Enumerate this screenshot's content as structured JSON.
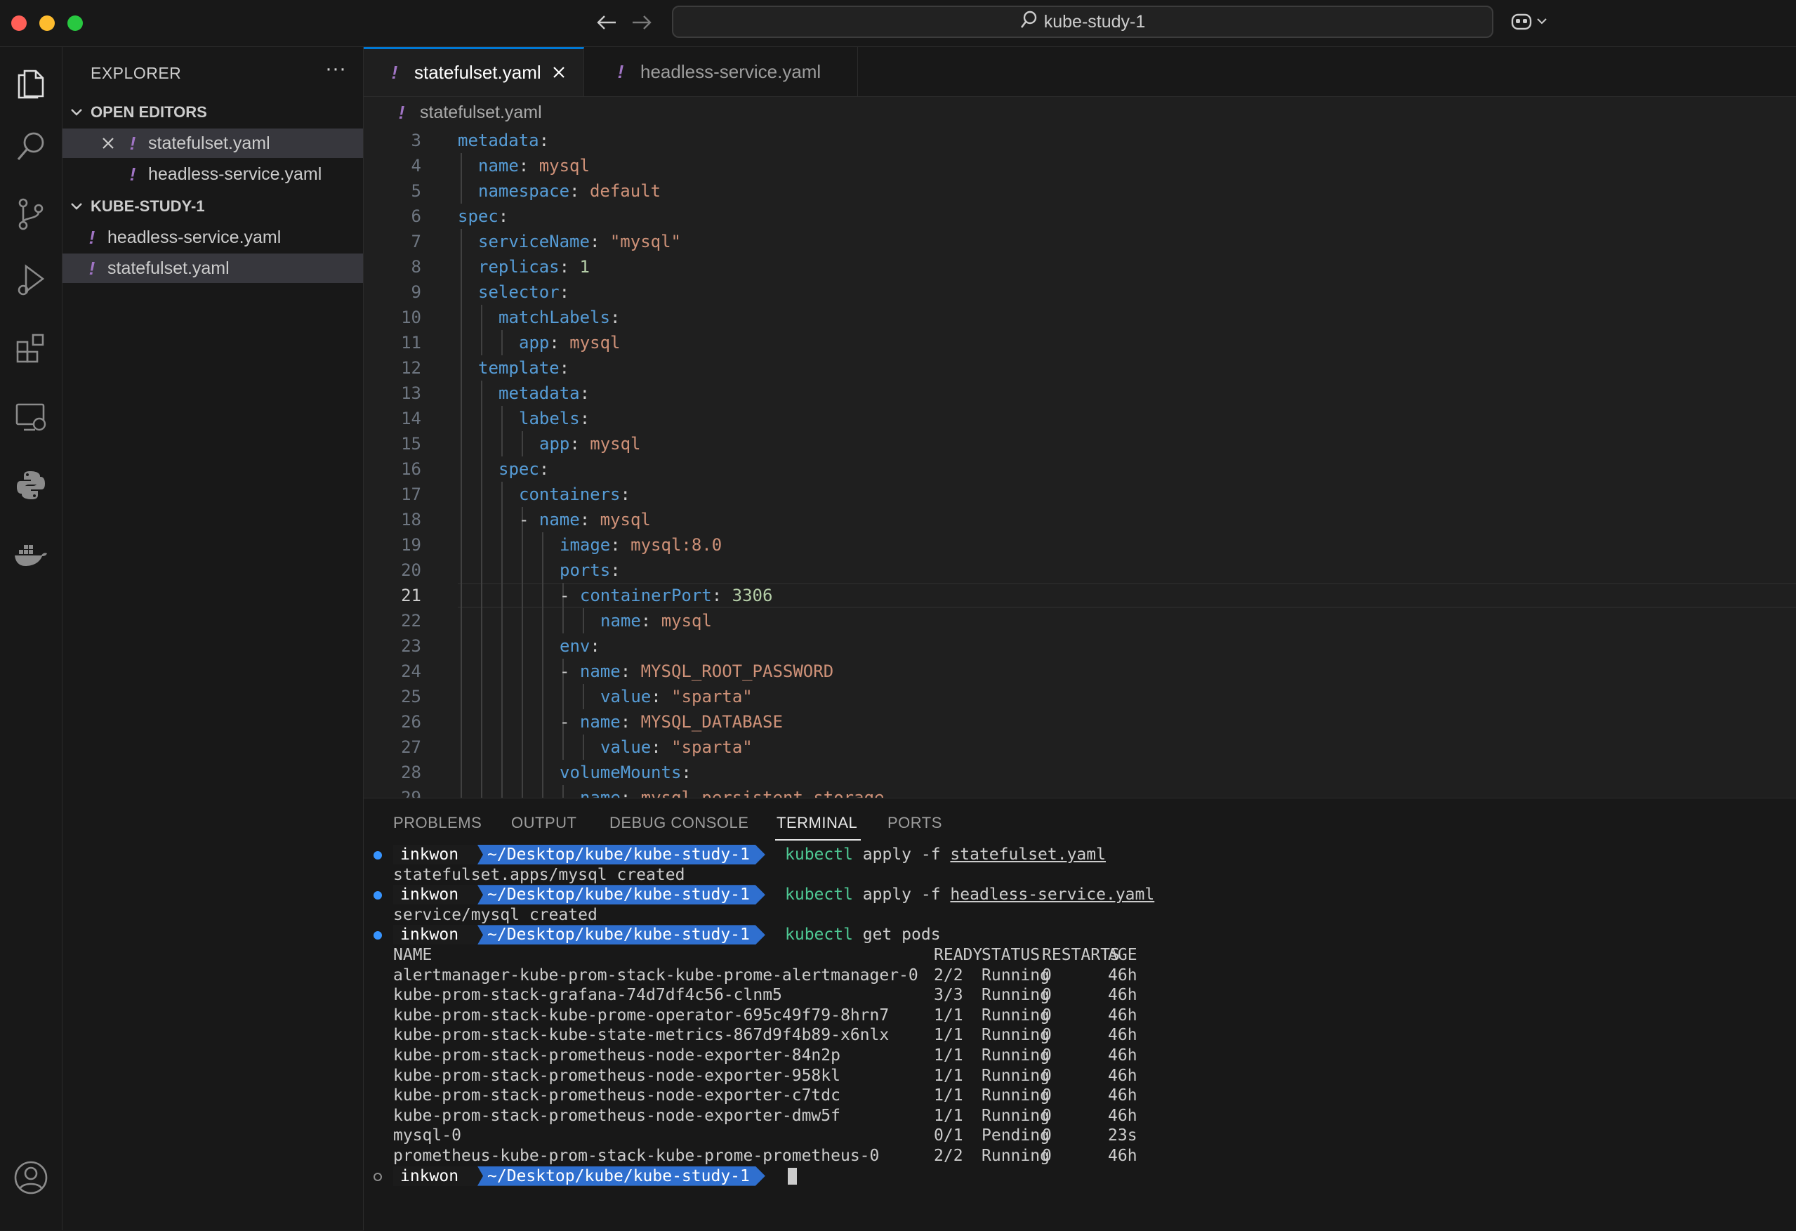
{
  "titlebar": {
    "search_text": "kube-study-1"
  },
  "sidebar": {
    "title": "EXPLORER",
    "more": "···",
    "open_editors": {
      "label": "OPEN EDITORS",
      "files": [
        {
          "name": "statefulset.yaml"
        },
        {
          "name": "headless-service.yaml"
        }
      ]
    },
    "folder": {
      "label": "KUBE-STUDY-1",
      "files": [
        {
          "name": "headless-service.yaml"
        },
        {
          "name": "statefulset.yaml"
        }
      ]
    },
    "file_marker": "!"
  },
  "editor": {
    "tabs": [
      {
        "label": "statefulset.yaml"
      },
      {
        "label": "headless-service.yaml"
      }
    ],
    "breadcrumb": "statefulset.yaml",
    "current_line": "21",
    "lines": [
      {
        "no": "3",
        "key": "metadata",
        "val": ""
      },
      {
        "no": "4",
        "key": "name",
        "val": "mysql"
      },
      {
        "no": "5",
        "key": "namespace",
        "val": "default"
      },
      {
        "no": "6",
        "key": "spec",
        "val": ""
      },
      {
        "no": "7",
        "key": "serviceName",
        "val": "\"mysql\""
      },
      {
        "no": "8",
        "key": "replicas",
        "val": "1"
      },
      {
        "no": "9",
        "key": "selector",
        "val": ""
      },
      {
        "no": "10",
        "key": "matchLabels",
        "val": ""
      },
      {
        "no": "11",
        "key": "app",
        "val": "mysql"
      },
      {
        "no": "12",
        "key": "template",
        "val": ""
      },
      {
        "no": "13",
        "key": "metadata",
        "val": ""
      },
      {
        "no": "14",
        "key": "labels",
        "val": ""
      },
      {
        "no": "15",
        "key": "app",
        "val": "mysql"
      },
      {
        "no": "16",
        "key": "spec",
        "val": ""
      },
      {
        "no": "17",
        "key": "containers",
        "val": ""
      },
      {
        "no": "18",
        "key": "name",
        "val": "mysql"
      },
      {
        "no": "19",
        "key": "image",
        "val": "mysql:8.0"
      },
      {
        "no": "20",
        "key": "ports",
        "val": ""
      },
      {
        "no": "21",
        "key": "containerPort",
        "val": "3306"
      },
      {
        "no": "22",
        "key": "name",
        "val": "mysql"
      },
      {
        "no": "23",
        "key": "env",
        "val": ""
      },
      {
        "no": "24",
        "key": "name",
        "val": "MYSQL_ROOT_PASSWORD"
      },
      {
        "no": "25",
        "key": "value",
        "val": "\"sparta\""
      },
      {
        "no": "26",
        "key": "name",
        "val": "MYSQL_DATABASE"
      },
      {
        "no": "27",
        "key": "value",
        "val": "\"sparta\""
      },
      {
        "no": "28",
        "key": "volumeMounts",
        "val": ""
      },
      {
        "no": "29",
        "key": "name",
        "val": "mysql-persistent-storage"
      }
    ]
  },
  "panel": {
    "tabs": [
      "PROBLEMS",
      "OUTPUT",
      "DEBUG CONSOLE",
      "TERMINAL",
      "PORTS"
    ],
    "terminal": {
      "user": "inkwon",
      "dir": "~/Desktop/kube/kube-study-1",
      "commands": [
        {
          "cmd": "kubectl",
          "args": "apply -f",
          "file": "statefulset.yaml",
          "output": "statefulset.apps/mysql created"
        },
        {
          "cmd": "kubectl",
          "args": "apply -f",
          "file": "headless-service.yaml",
          "output": "service/mysql created"
        },
        {
          "cmd": "kubectl",
          "args": "get pods",
          "file": "",
          "output": ""
        }
      ],
      "headers": [
        "NAME",
        "READY",
        "STATUS",
        "RESTARTS",
        "AGE"
      ],
      "pods": [
        [
          "alertmanager-kube-prom-stack-kube-prome-alertmanager-0",
          "2/2",
          "Running",
          "0",
          "46h"
        ],
        [
          "kube-prom-stack-grafana-74d7df4c56-clnm5",
          "3/3",
          "Running",
          "0",
          "46h"
        ],
        [
          "kube-prom-stack-kube-prome-operator-695c49f79-8hrn7",
          "1/1",
          "Running",
          "0",
          "46h"
        ],
        [
          "kube-prom-stack-kube-state-metrics-867d9f4b89-x6nlx",
          "1/1",
          "Running",
          "0",
          "46h"
        ],
        [
          "kube-prom-stack-prometheus-node-exporter-84n2p",
          "1/1",
          "Running",
          "0",
          "46h"
        ],
        [
          "kube-prom-stack-prometheus-node-exporter-958kl",
          "1/1",
          "Running",
          "0",
          "46h"
        ],
        [
          "kube-prom-stack-prometheus-node-exporter-c7tdc",
          "1/1",
          "Running",
          "0",
          "46h"
        ],
        [
          "kube-prom-stack-prometheus-node-exporter-dmw5f",
          "1/1",
          "Running",
          "0",
          "46h"
        ],
        [
          "mysql-0",
          "0/1",
          "Pending",
          "0",
          "23s"
        ],
        [
          "prometheus-kube-prom-stack-kube-prome-prometheus-0",
          "2/2",
          "Running",
          "0",
          "46h"
        ]
      ]
    }
  },
  "colors": {
    "accent": "#0078d4",
    "yaml_key": "#569cd6",
    "yaml_string": "#ce9178",
    "yaml_number": "#b5cea8",
    "file_marker": "#a074c4",
    "prompt_dir_bg": "#2f6fcf",
    "terminal_cmd": "#4ec994"
  },
  "icons": [
    "explorer-icon",
    "search-icon",
    "source-control-icon",
    "run-debug-icon",
    "extensions-icon",
    "remote-explorer-icon",
    "python-icon",
    "docker-icon",
    "account-icon"
  ]
}
